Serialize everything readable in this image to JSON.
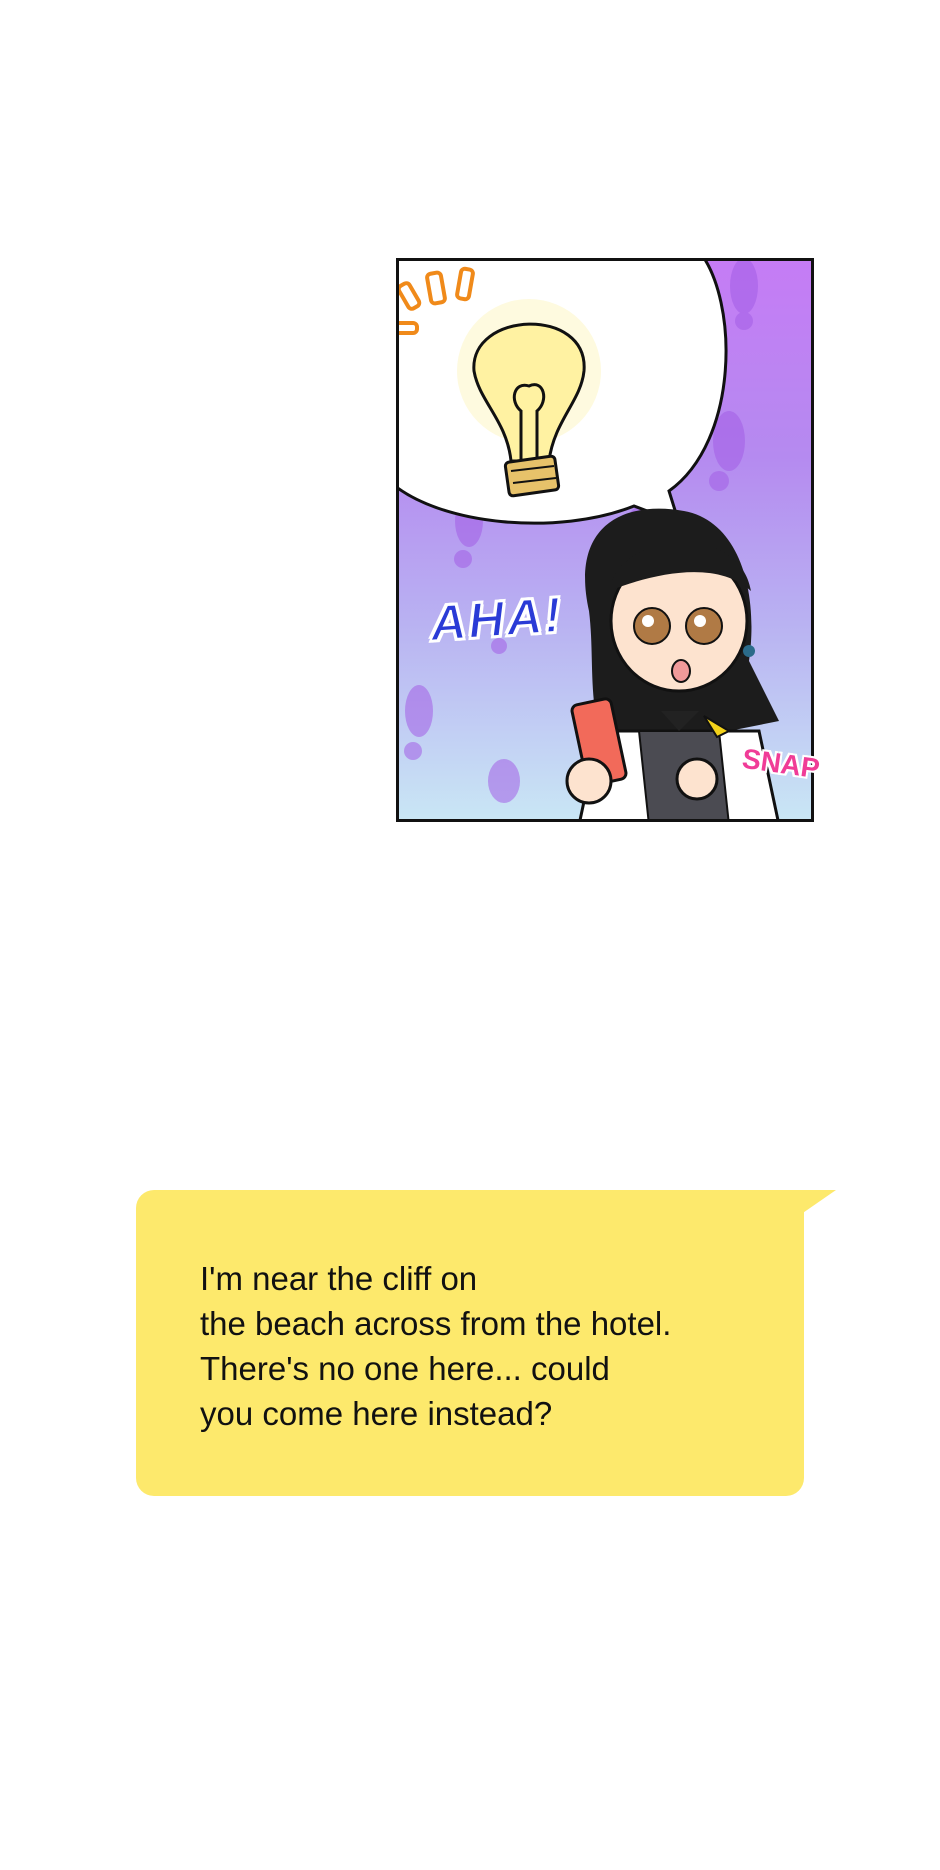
{
  "panel": {
    "sfx_main": "AHA!",
    "sfx_side": "SNAP"
  },
  "message": {
    "lines": [
      "I'm near the cliff on",
      "the beach across from the hotel.",
      "There's no one here... could",
      "you come here instead?"
    ]
  },
  "colors": {
    "bubble": "#fde96c",
    "aha": "#2a3bd6",
    "snap": "#f03c97",
    "panel_top": "#c57cf5",
    "panel_bottom": "#c9e6f5"
  }
}
